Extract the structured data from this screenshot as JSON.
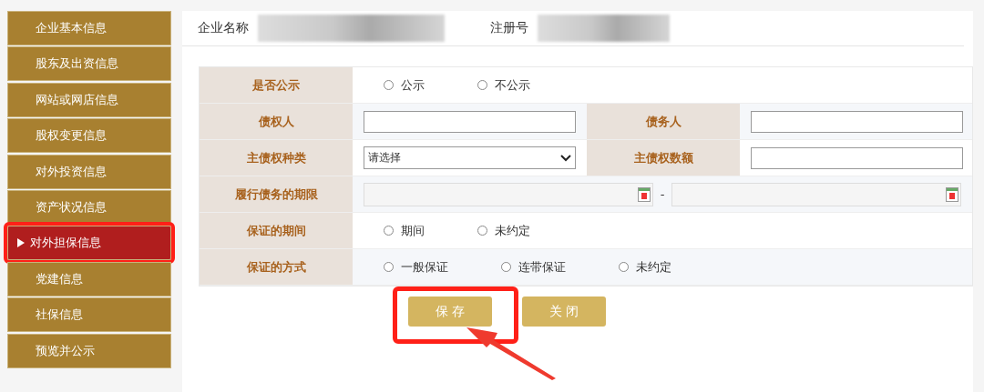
{
  "sidebar": {
    "items": [
      {
        "label": "企业基本信息",
        "selected": false
      },
      {
        "label": "股东及出资信息",
        "selected": false
      },
      {
        "label": "网站或网店信息",
        "selected": false
      },
      {
        "label": "股权变更信息",
        "selected": false
      },
      {
        "label": "对外投资信息",
        "selected": false
      },
      {
        "label": "资产状况信息",
        "selected": false
      },
      {
        "label": "对外担保信息",
        "selected": true
      },
      {
        "label": "党建信息",
        "selected": false
      },
      {
        "label": "社保信息",
        "selected": false
      },
      {
        "label": "预览并公示",
        "selected": false
      }
    ]
  },
  "header": {
    "fields": [
      {
        "label": "企业名称",
        "kind": "redacted"
      },
      {
        "label": "注册号",
        "kind": "redacted"
      }
    ]
  },
  "form": {
    "rows": [
      {
        "kind": "radios",
        "label": "是否公示",
        "options": [
          {
            "label": "公示",
            "selected": false
          },
          {
            "label": "不公示",
            "selected": false
          }
        ]
      },
      {
        "kind": "pair",
        "cells": [
          {
            "label": "债权人",
            "kind": "text"
          },
          {
            "label": "债务人",
            "kind": "text"
          }
        ]
      },
      {
        "kind": "pair",
        "cells": [
          {
            "label": "主债权种类",
            "kind": "select",
            "value": "请选择"
          },
          {
            "label": "主债权数额",
            "kind": "text"
          }
        ]
      },
      {
        "kind": "daterange",
        "label": "履行债务的期限",
        "separator": "-"
      },
      {
        "kind": "radios",
        "label": "保证的期间",
        "options": [
          {
            "label": "期间",
            "selected": false
          },
          {
            "label": "未约定",
            "selected": false
          }
        ]
      },
      {
        "kind": "radios",
        "label": "保证的方式",
        "options": [
          {
            "label": "一般保证",
            "selected": false
          },
          {
            "label": "连带保证",
            "selected": false
          },
          {
            "label": "未约定",
            "selected": false
          }
        ]
      }
    ]
  },
  "buttons": [
    {
      "label": "保 存",
      "highlighted": true
    },
    {
      "label": "关 闭",
      "highlighted": false
    }
  ]
}
